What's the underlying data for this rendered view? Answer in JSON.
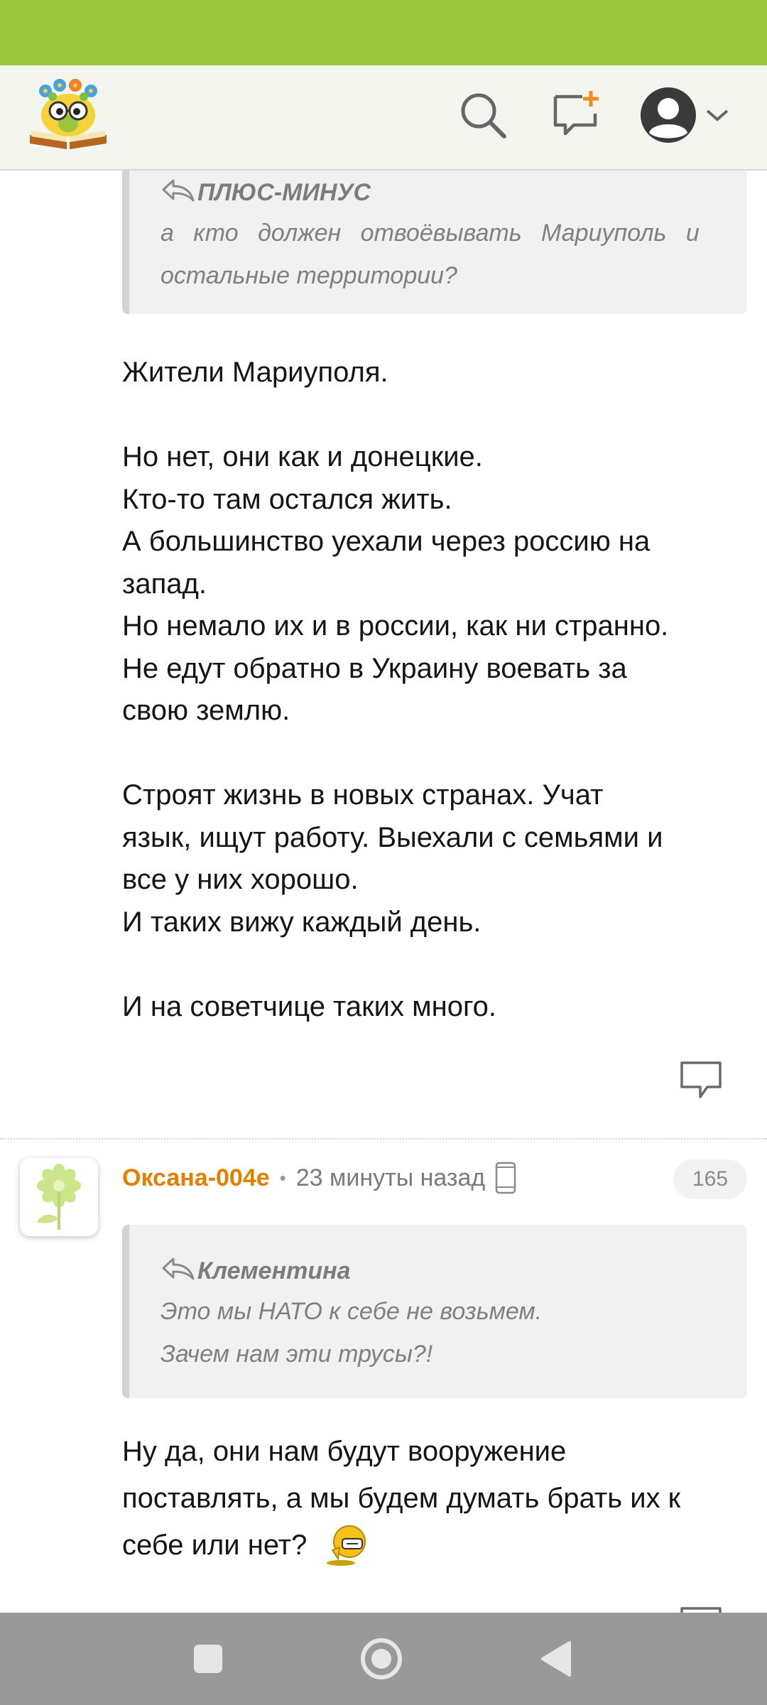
{
  "colors": {
    "status_bar": "#9bc53d",
    "author_name": "#e67e00",
    "header_bg": "#f5f5f0",
    "nav_bar": "#999999"
  },
  "header": {
    "logo": "owl-reading-book-logo",
    "icons": [
      "search-icon",
      "new-message-icon",
      "profile-avatar-icon",
      "chevron-down-icon"
    ]
  },
  "comment1": {
    "quote": {
      "author": "ПЛЮС-МИНУС",
      "lines": [
        "а кто должен отвоёвывать Мариуполь и",
        "остальные территории?"
      ]
    },
    "paragraphs": [
      [
        "Жители Мариуполя."
      ],
      [
        "Но нет, они как и донецкие.",
        "Кто-то там остался жить.",
        "А большинство уехали через россию на",
        "запад.",
        "Но немало их и в россии, как ни странно.",
        "Не едут обратно в Украину воевать за",
        "свою землю."
      ],
      [
        "Строят жизнь в новых странах. Учат",
        "язык, ищут работу. Выехали с семьями и",
        "все у них хорошо.",
        "И таких вижу каждый день."
      ],
      [
        "И на советчице таких много."
      ]
    ]
  },
  "comment2": {
    "author": "Оксана-004е",
    "separator": "•",
    "time": "23 минуты назад",
    "counter": "165",
    "quote": {
      "author": "Клементина",
      "lines": [
        "Это мы НАТО к себе не возьмем.",
        "Зачем нам эти трусы?!"
      ]
    },
    "text_lines": [
      "Ну да, они нам будут вооружение",
      "поставлять, а мы будем думать брать их к",
      "себе или нет?"
    ],
    "emoji": "thinking-smiley-icon"
  },
  "navigation": [
    "recent-apps-button",
    "home-button",
    "back-button"
  ]
}
